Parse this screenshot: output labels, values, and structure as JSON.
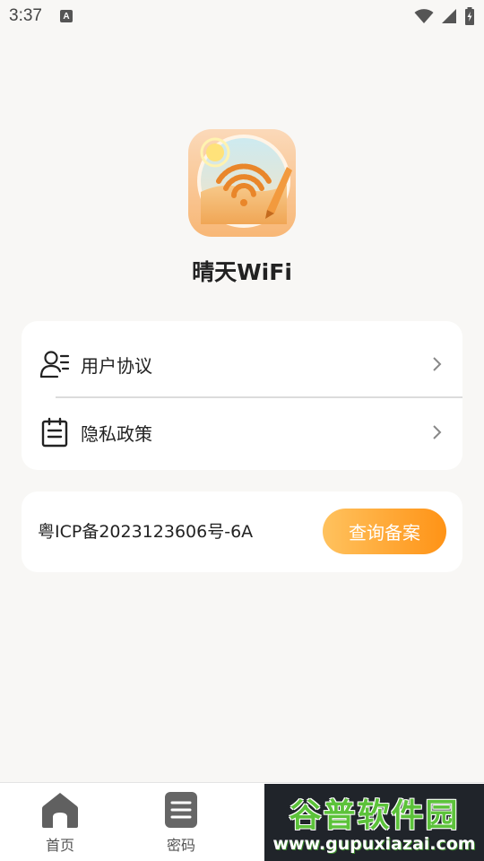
{
  "status_bar": {
    "time": "3:37",
    "notification_icon": "a-icon",
    "wifi_icon": "wifi-icon",
    "signal_icon": "signal-icon",
    "battery_icon": "battery-charging-icon"
  },
  "app": {
    "name": "晴天WiFi",
    "logo_icon": "sunny-wifi-logo-icon"
  },
  "menu": {
    "items": [
      {
        "label": "用户协议",
        "icon": "user-list-icon"
      },
      {
        "label": "隐私政策",
        "icon": "clipboard-icon"
      }
    ]
  },
  "icp": {
    "text": "粤ICP备2023123606号-6A",
    "button_label": "查询备案"
  },
  "tabs": [
    {
      "label": "首页",
      "icon": "home-icon"
    },
    {
      "label": "密码",
      "icon": "document-icon"
    }
  ],
  "watermark": {
    "title": "谷普软件园",
    "url": "www.gupuxiazai.com"
  },
  "colors": {
    "background": "#f8f7f5",
    "accent_start": "#ffc25e",
    "accent_end": "#ff9316"
  }
}
